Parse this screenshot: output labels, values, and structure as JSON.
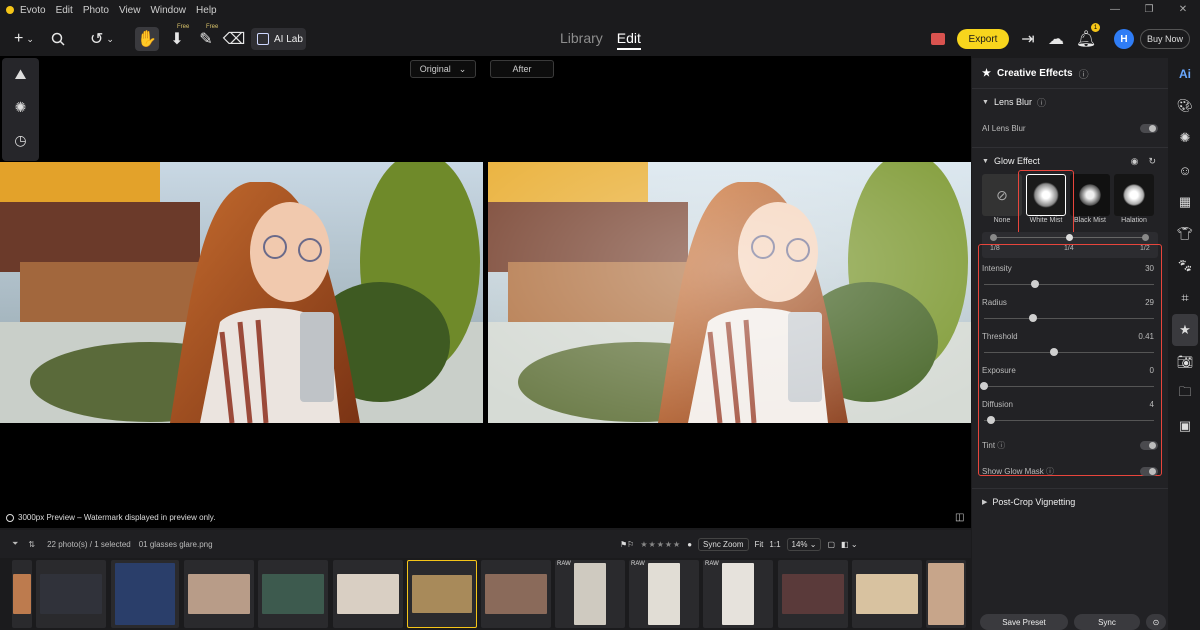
{
  "app": {
    "name": "Evoto"
  },
  "menu": [
    "Evoto",
    "Edit",
    "Photo",
    "View",
    "Window",
    "Help"
  ],
  "toolbar": {
    "free_tag": "Free",
    "ai_lab": "AI Lab",
    "tabs": {
      "library": "Library",
      "edit": "Edit"
    },
    "export": "Export",
    "avatar_initial": "H",
    "buy_now": "Buy Now",
    "notif_count": "1"
  },
  "compare": {
    "original": "Original",
    "after": "After"
  },
  "preview_note": "3000px Preview – Watermark displayed in preview only.",
  "panel": {
    "title": "Creative Effects",
    "lens_blur": {
      "title": "Lens Blur",
      "ai_label": "AI Lens Blur"
    },
    "glow": {
      "title": "Glow Effect",
      "effects": [
        "None",
        "White Mist",
        "Black Mist",
        "Halation"
      ],
      "size_labels": [
        "1/8",
        "1/4",
        "1/2"
      ],
      "sliders": [
        {
          "name": "Intensity",
          "value": "30",
          "pos": 0.3
        },
        {
          "name": "Radius",
          "value": "29",
          "pos": 0.29
        },
        {
          "name": "Threshold",
          "value": "0.41",
          "pos": 0.41
        },
        {
          "name": "Exposure",
          "value": "0",
          "pos": 0.0
        },
        {
          "name": "Diffusion",
          "value": "4",
          "pos": 0.04
        }
      ],
      "tint": "Tint",
      "show_mask": "Show Glow Mask"
    },
    "vignette": "Post-Crop Vignetting",
    "save_preset": "Save Preset",
    "sync": "Sync"
  },
  "filmstrip": {
    "count": "22 photo(s) / 1 selected",
    "filename": "01 glasses glare.png",
    "sync_zoom": "Sync Zoom",
    "fit": "Fit",
    "one_to_one": "1:1",
    "zoom": "14%",
    "raw": "RAW"
  },
  "colors": {
    "accent": "#f7d51d",
    "highlight": "#e8453c",
    "avatar": "#2f7df6"
  }
}
